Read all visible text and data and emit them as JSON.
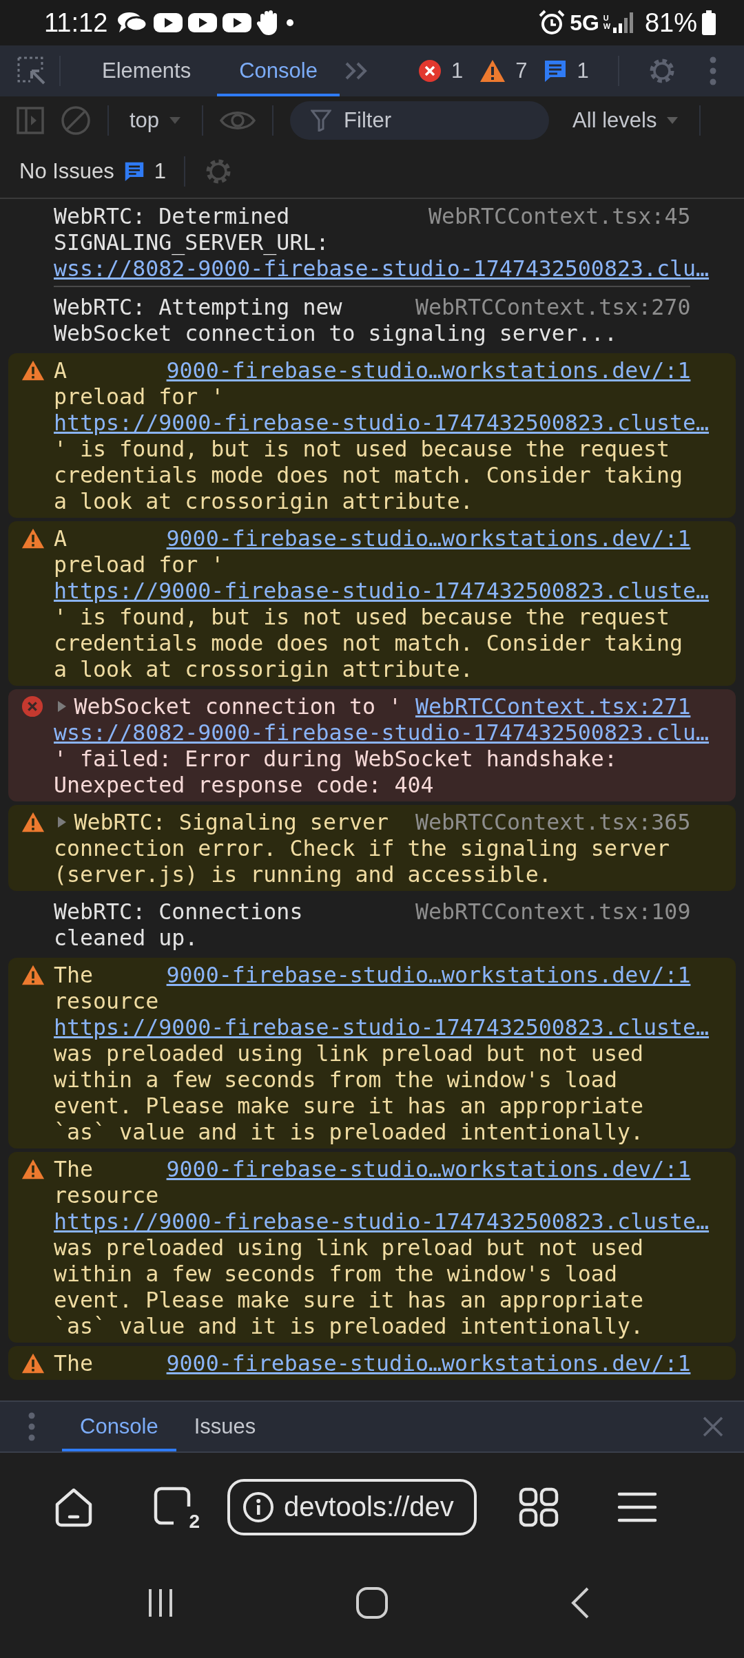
{
  "status_bar": {
    "time": "11:12",
    "network": "5G",
    "network_sub": "UW",
    "battery": "81%"
  },
  "devtools_tabs": [
    {
      "label": "Elements",
      "selected": false
    },
    {
      "label": "Console",
      "selected": true
    }
  ],
  "counts": {
    "errors": "1",
    "warnings": "7",
    "messages": "1"
  },
  "toolbar": {
    "context": "top",
    "filter_placeholder": "Filter",
    "levels": "All levels"
  },
  "issues": {
    "label": "No Issues",
    "count": "1"
  },
  "messages": [
    {
      "kind": "info",
      "expandable": false,
      "first_line": "WebRTC: Determined",
      "source": "WebRTCContext.tsx:45",
      "source_link": false,
      "parts": [
        {
          "kind": "text",
          "text": "SIGNALING_SERVER_URL:"
        },
        {
          "kind": "link",
          "text": "wss://8082-9000-firebase-studio-1747432500823.clu…"
        }
      ]
    },
    {
      "kind": "info",
      "expandable": false,
      "first_line": "WebRTC: Attempting new",
      "source": "WebRTCContext.tsx:270",
      "source_link": false,
      "parts": [
        {
          "kind": "text",
          "text": "WebSocket connection to signaling server..."
        }
      ]
    },
    {
      "kind": "warning",
      "expandable": false,
      "first_line": "A",
      "source": "9000-firebase-studio…workstations.dev/:1",
      "source_link": true,
      "parts": [
        {
          "kind": "text",
          "text": "preload for '"
        },
        {
          "kind": "link",
          "text": "https://9000-firebase-studio-1747432500823.cluste…"
        },
        {
          "kind": "text",
          "text": "' is found, but is not used because the request credentials mode does not match. Consider taking a look at crossorigin attribute."
        }
      ]
    },
    {
      "kind": "warning",
      "expandable": false,
      "first_line": "A",
      "source": "9000-firebase-studio…workstations.dev/:1",
      "source_link": true,
      "parts": [
        {
          "kind": "text",
          "text": "preload for '"
        },
        {
          "kind": "link",
          "text": "https://9000-firebase-studio-1747432500823.cluste…"
        },
        {
          "kind": "text",
          "text": "' is found, but is not used because the request credentials mode does not match. Consider taking a look at crossorigin attribute."
        }
      ]
    },
    {
      "kind": "error",
      "expandable": true,
      "first_line": "WebSocket connection to '",
      "source": "WebRTCContext.tsx:271",
      "source_link": true,
      "parts": [
        {
          "kind": "link",
          "text": "wss://8082-9000-firebase-studio-1747432500823.clu…"
        },
        {
          "kind": "text",
          "text": "' failed: Error during WebSocket handshake: Unexpected response code: 404"
        }
      ]
    },
    {
      "kind": "warning",
      "expandable": true,
      "first_line": "WebRTC: Signaling server",
      "source": "WebRTCContext.tsx:365",
      "source_link": false,
      "parts": [
        {
          "kind": "text",
          "text": "connection error. Check if the signaling server (server.js) is running and accessible."
        }
      ]
    },
    {
      "kind": "info",
      "expandable": false,
      "first_line": "WebRTC: Connections",
      "source": "WebRTCContext.tsx:109",
      "source_link": false,
      "parts": [
        {
          "kind": "text",
          "text": "cleaned up."
        }
      ]
    },
    {
      "kind": "warning",
      "expandable": false,
      "first_line": "The",
      "source": "9000-firebase-studio…workstations.dev/:1",
      "source_link": true,
      "parts": [
        {
          "kind": "text",
          "text": "resource"
        },
        {
          "kind": "link",
          "text": "https://9000-firebase-studio-1747432500823.cluste…"
        },
        {
          "kind": "text",
          "text": "was preloaded using link preload but not used within a few seconds from the window's load event. Please make sure it has an appropriate `as` value and it is preloaded intentionally."
        }
      ]
    },
    {
      "kind": "warning",
      "expandable": false,
      "first_line": "The",
      "source": "9000-firebase-studio…workstations.dev/:1",
      "source_link": true,
      "parts": [
        {
          "kind": "text",
          "text": "resource"
        },
        {
          "kind": "link",
          "text": "https://9000-firebase-studio-1747432500823.cluste…"
        },
        {
          "kind": "text",
          "text": "was preloaded using link preload but not used within a few seconds from the window's load event. Please make sure it has an appropriate `as` value and it is preloaded intentionally."
        }
      ]
    },
    {
      "kind": "warning",
      "expandable": false,
      "first_line": "The",
      "source": "9000-firebase-studio…workstations.dev/:1",
      "source_link": true
    }
  ],
  "drawer_tabs": [
    {
      "label": "Console",
      "selected": true
    },
    {
      "label": "Issues",
      "selected": false
    }
  ],
  "browser": {
    "url": "devtools://dev",
    "tab_count": "2"
  }
}
